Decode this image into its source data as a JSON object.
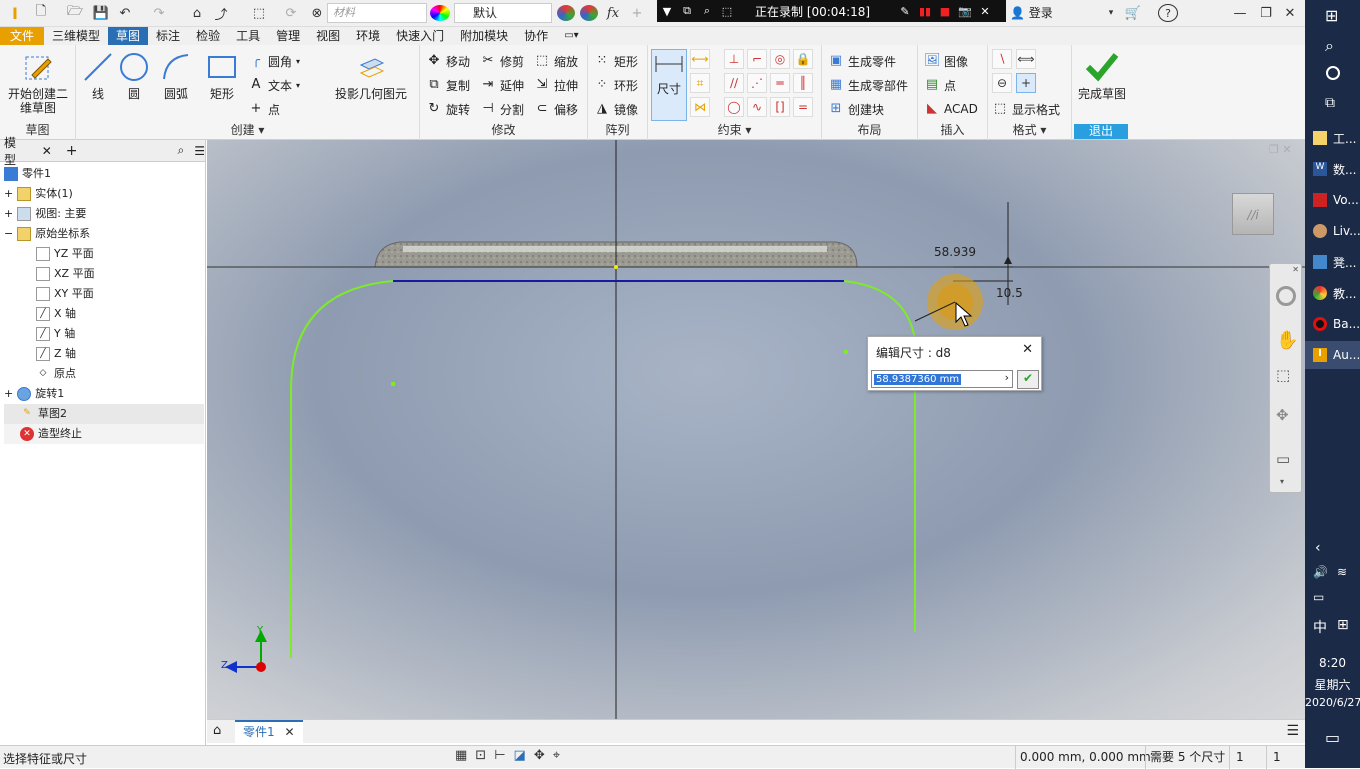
{
  "qat": {
    "material_placeholder": "材料",
    "style_value": "默认",
    "login_label": "登录"
  },
  "recorder": {
    "status": "正在录制 [00:04:18]"
  },
  "menu": [
    "文件",
    "三维模型",
    "草图",
    "标注",
    "检验",
    "工具",
    "管理",
    "视图",
    "环境",
    "快速入门",
    "附加模块",
    "协作"
  ],
  "ribbon": {
    "sketch_group": {
      "start_label": "开始创建二维草图",
      "label": "草图"
    },
    "create_group": {
      "line": "线",
      "circle": "圆",
      "arc": "圆弧",
      "rect": "矩形",
      "fillet": "圆角",
      "text": "文本",
      "point": "点",
      "project": "投影几何图元",
      "label": "创建"
    },
    "modify_group": {
      "move": "移动",
      "trim": "修剪",
      "scale": "缩放",
      "copy": "复制",
      "extend": "延伸",
      "stretch": "拉伸",
      "rotate": "旋转",
      "split": "分割",
      "offset": "偏移",
      "label": "修改"
    },
    "pattern_group": {
      "rect": "矩形",
      "ring": "环形",
      "mirror": "镜像",
      "label": "阵列"
    },
    "constraint_group": {
      "dimension": "尺寸",
      "label": "约束"
    },
    "layout_group": {
      "gen_part": "生成零件",
      "gen_parts": "生成零部件",
      "create_block": "创建块",
      "label": "布局"
    },
    "insert_group": {
      "image": "图像",
      "point": "点",
      "acad": "ACAD",
      "label": "插入"
    },
    "format_group": {
      "display_format": "显示格式",
      "label": "格式"
    },
    "exit_group": {
      "finish": "完成草图",
      "label": "退出"
    }
  },
  "browser": {
    "tab_label": "模型",
    "items": [
      {
        "label": "零件1"
      },
      {
        "label": "实体(1)"
      },
      {
        "label": "视图: 主要"
      },
      {
        "label": "原始坐标系"
      },
      {
        "label": "YZ 平面"
      },
      {
        "label": "XZ 平面"
      },
      {
        "label": "XY 平面"
      },
      {
        "label": "X 轴"
      },
      {
        "label": "Y 轴"
      },
      {
        "label": "Z 轴"
      },
      {
        "label": "原点"
      },
      {
        "label": "旋转1"
      },
      {
        "label": "草图2"
      },
      {
        "label": "造型终止"
      }
    ]
  },
  "viewport": {
    "dim_width": "58.939",
    "dim_height": "10.5",
    "triad": {
      "y": "Y",
      "z": "Z"
    }
  },
  "dialog": {
    "title": "编辑尺寸 : d8",
    "value": "58.9387360 mm"
  },
  "doc_tabs": [
    {
      "label": "零件1"
    }
  ],
  "status": {
    "message": "选择特征或尺寸",
    "coords": "0.000 mm, 0.000 mm",
    "needed": "需要 5 个尺寸",
    "count1": "1",
    "count2": "1"
  },
  "taskbar": {
    "items": [
      "工...",
      "数...",
      "Vo...",
      "Liv...",
      "凳...",
      "教...",
      "Ba...",
      "Au..."
    ],
    "ime": "中",
    "time": "8:20",
    "weekday": "星期六",
    "date": "2020/6/27"
  },
  "colors": {
    "accent": "#2a6fb5",
    "file_menu": "#e8a000",
    "sketch_green": "#7dea2a",
    "sketch_line": "#1a1aa0"
  }
}
